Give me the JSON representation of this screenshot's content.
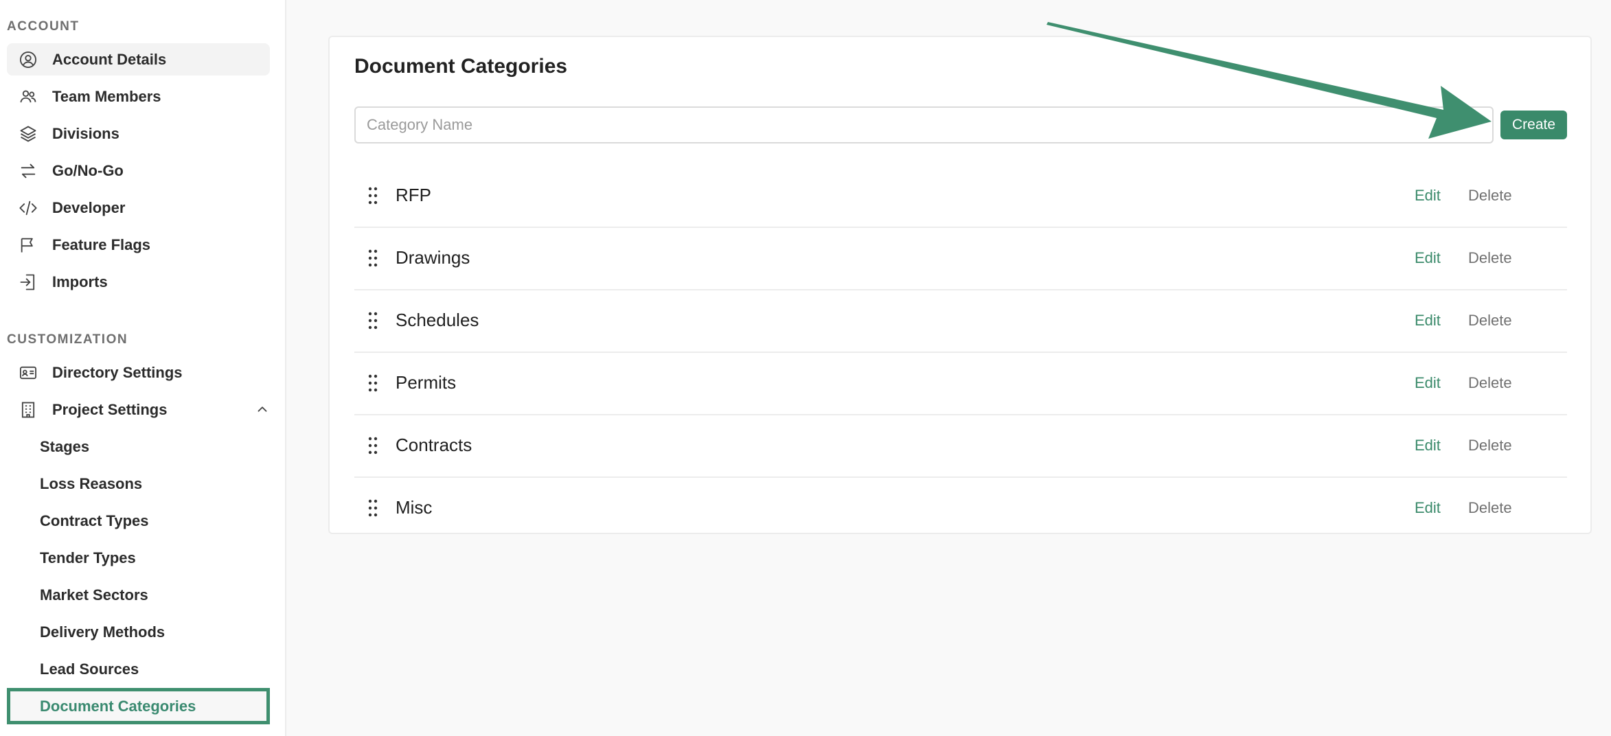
{
  "sidebar": {
    "account_heading": "ACCOUNT",
    "account_items": [
      {
        "label": "Account Details",
        "icon": "user-circle-icon"
      },
      {
        "label": "Team Members",
        "icon": "users-icon"
      },
      {
        "label": "Divisions",
        "icon": "layers-icon"
      },
      {
        "label": "Go/No-Go",
        "icon": "arrows-exchange-icon"
      },
      {
        "label": "Developer",
        "icon": "code-icon"
      },
      {
        "label": "Feature Flags",
        "icon": "flag-icon"
      },
      {
        "label": "Imports",
        "icon": "import-icon"
      }
    ],
    "customization_heading": "CUSTOMIZATION",
    "customization_items": [
      {
        "label": "Directory Settings",
        "icon": "id-card-icon"
      },
      {
        "label": "Project Settings",
        "icon": "building-icon"
      }
    ],
    "project_settings_subitems": [
      {
        "label": "Stages"
      },
      {
        "label": "Loss Reasons"
      },
      {
        "label": "Contract Types"
      },
      {
        "label": "Tender Types"
      },
      {
        "label": "Market Sectors"
      },
      {
        "label": "Delivery Methods"
      },
      {
        "label": "Lead Sources"
      },
      {
        "label": "Document Categories"
      }
    ]
  },
  "main": {
    "title": "Document Categories",
    "input_placeholder": "Category Name",
    "input_value": "",
    "create_label": "Create",
    "edit_label": "Edit",
    "delete_label": "Delete",
    "categories": [
      {
        "name": "RFP"
      },
      {
        "name": "Drawings"
      },
      {
        "name": "Schedules"
      },
      {
        "name": "Permits"
      },
      {
        "name": "Contracts"
      },
      {
        "name": "Misc"
      }
    ]
  },
  "colors": {
    "accent": "#3a8a6a",
    "highlight_border": "#3f8f6f",
    "annotation_arrow": "#3f8f6f"
  }
}
